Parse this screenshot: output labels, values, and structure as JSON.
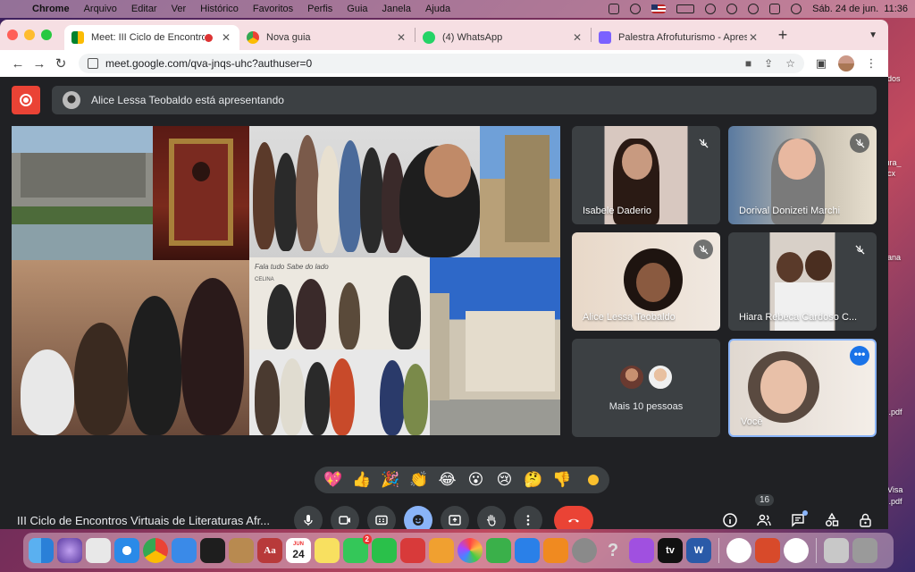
{
  "menubar": {
    "app": "Chrome",
    "items": [
      "Arquivo",
      "Editar",
      "Ver",
      "Histórico",
      "Favoritos",
      "Perfis",
      "Guia",
      "Janela",
      "Ajuda"
    ],
    "datetime": "Sáb. 24 de jun.  11:36"
  },
  "desktop": {
    "labels": [
      "ados",
      "tura_",
      "ocx",
      "nana",
      "L",
      "D.pdf",
      "t Visa",
      "D.pdf"
    ]
  },
  "tabs": [
    {
      "title": "Meet: III Ciclo de Encontros",
      "active": true,
      "recording": true
    },
    {
      "title": "Nova guia",
      "active": false
    },
    {
      "title": "(4) WhatsApp",
      "active": false
    },
    {
      "title": "Palestra Afrofuturismo - Apresen",
      "active": false
    }
  ],
  "address": {
    "url": "meet.google.com/qva-jnqs-uhc?authuser=0"
  },
  "meet": {
    "presenter_banner": "Alice Lessa Teobaldo está apresentando",
    "participants": [
      {
        "name": "Isabele Daderio",
        "muted": true
      },
      {
        "name": "Dorival Donizeti Marchi",
        "muted": true
      },
      {
        "name": "Alice Lessa Teobaldo",
        "muted": true
      },
      {
        "name": "Hiara Rebeca Cardoso C...",
        "muted": true
      },
      {
        "name": "Mais 10 pessoas"
      },
      {
        "name": "Você",
        "self": true
      }
    ],
    "reactions": [
      "💖",
      "👍",
      "🎉",
      "👏",
      "😂",
      "😮",
      "😢",
      "🤔",
      "👎"
    ],
    "meeting_title": "III Ciclo de Encontros Virtuais de Literaturas Afr...",
    "people_count": "16",
    "colors": {
      "accent": "#8ab4f8",
      "hangup": "#ea4335",
      "bg": "#202124",
      "tile": "#3c4043"
    }
  },
  "slide_photo_text": {
    "sign": "Fala tudo   Sabe do lado",
    "sign2": "CELINA"
  },
  "dock": {
    "calendar_month": "JUN",
    "calendar_day": "24",
    "messages_badge": "2",
    "word_label": "W",
    "tv_label": "tv"
  }
}
